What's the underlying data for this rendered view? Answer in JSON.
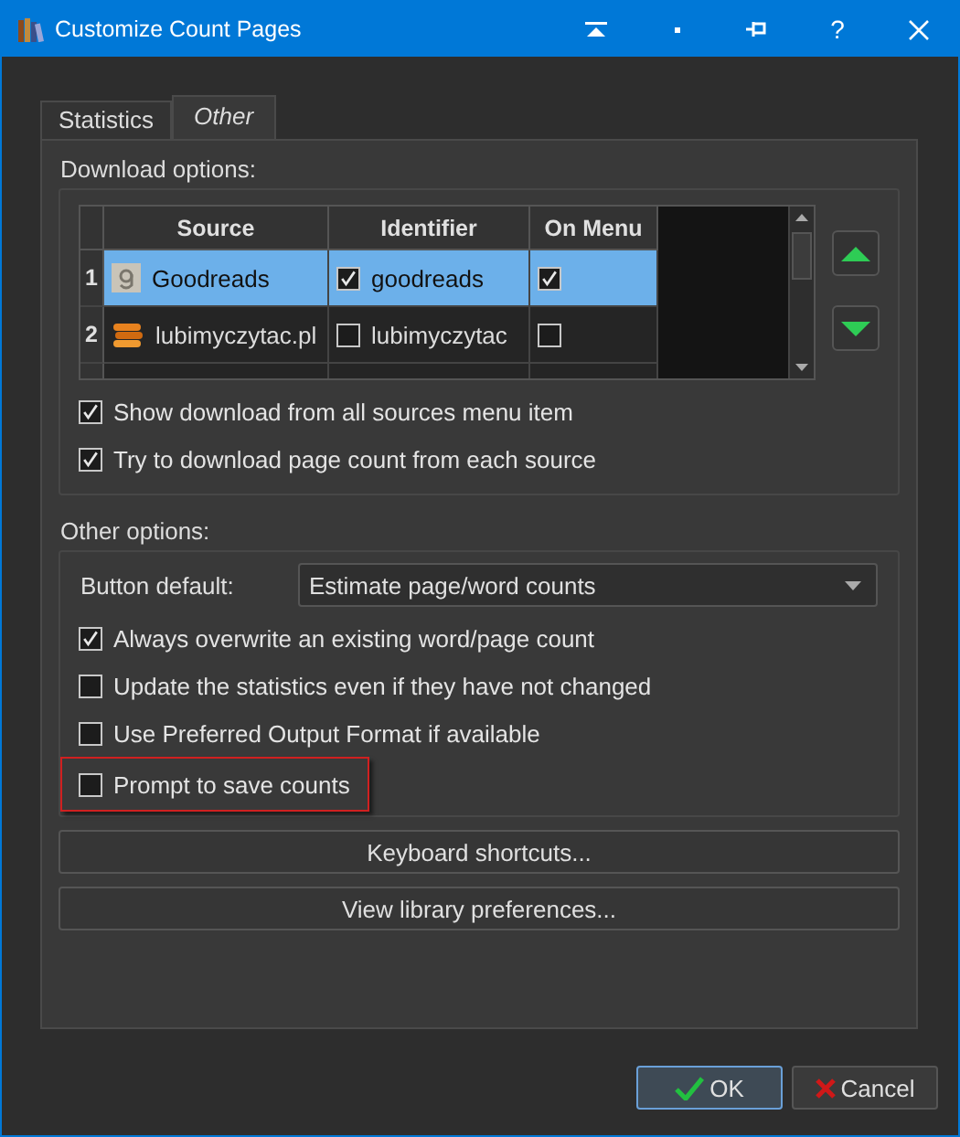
{
  "window": {
    "title": "Customize Count Pages",
    "help_button": "?"
  },
  "tabs": [
    {
      "label": "Statistics",
      "selected": false
    },
    {
      "label": "Other",
      "selected": true
    }
  ],
  "download_options": {
    "label": "Download options:",
    "table": {
      "columns": [
        "Source",
        "Identifier",
        "On Menu"
      ],
      "rows": [
        {
          "number": "1",
          "source": "Goodreads",
          "identifier": "goodreads",
          "identifier_checked": true,
          "on_menu": true,
          "selected": true
        },
        {
          "number": "2",
          "source": "lubimyczytac.pl",
          "identifier": "lubimyczytac",
          "identifier_checked": false,
          "on_menu": false,
          "selected": false
        }
      ]
    },
    "checks": [
      {
        "label": "Show download from all sources menu item",
        "checked": true
      },
      {
        "label": "Try to download page count from each source",
        "checked": true
      }
    ]
  },
  "other_options": {
    "label": "Other options:",
    "button_default": {
      "label": "Button default:",
      "value": "Estimate page/word counts"
    },
    "checks": [
      {
        "label": "Always overwrite an existing word/page count",
        "checked": true,
        "focused": false
      },
      {
        "label": "Update the statistics even if they have not changed",
        "checked": false,
        "focused": false
      },
      {
        "label": "Use Preferred Output Format if available",
        "checked": false,
        "focused": false
      },
      {
        "label": "Prompt to save counts",
        "checked": false,
        "focused": true
      }
    ]
  },
  "buttons": [
    "Keyboard shortcuts...",
    "View library preferences..."
  ],
  "dialog_buttons": [
    {
      "label": "OK",
      "kind": "ok",
      "default": true
    },
    {
      "label": "Cancel",
      "kind": "cancel",
      "default": false
    }
  ]
}
